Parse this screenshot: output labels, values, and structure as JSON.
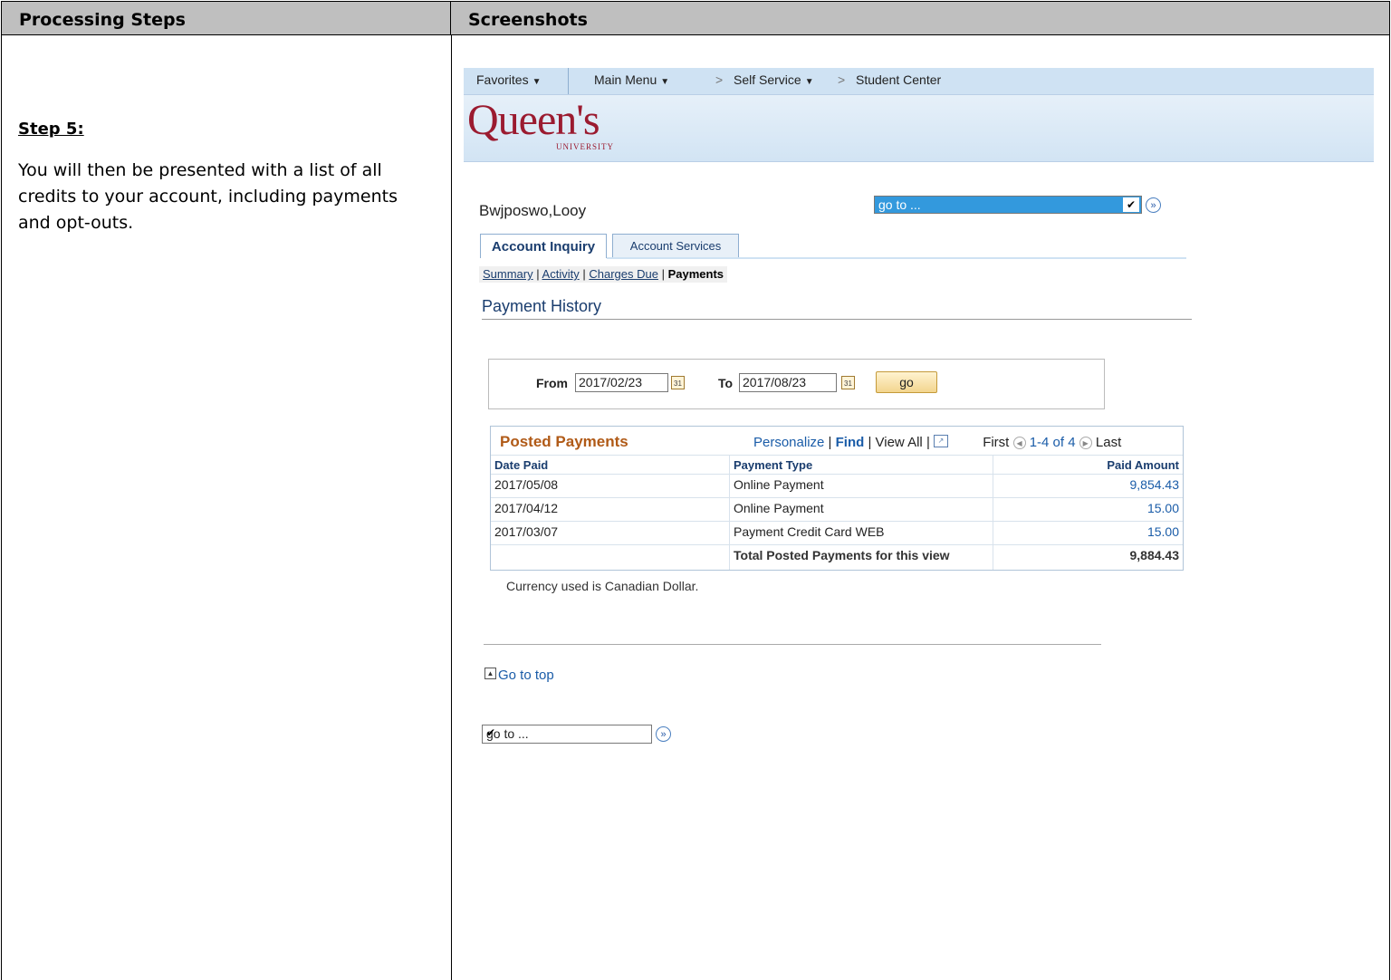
{
  "document": {
    "col_left_header": "Processing Steps",
    "col_right_header": "Screenshots",
    "step_title": "Step 5:",
    "step_text": "You will then be presented with a list of all credits to your account, including payments and opt-outs."
  },
  "app": {
    "topbar": {
      "favorites": "Favorites",
      "main_menu": "Main Menu",
      "self_service": "Self Service",
      "student_center": "Student Center",
      "crumb_sep": ">"
    },
    "logo": {
      "main": "Queen's",
      "sub": "UNIVERSITY"
    },
    "user_name": "Bwjposwo,Looy",
    "goto_top_value": "go to ...",
    "tabs": [
      {
        "label": "Account Inquiry"
      },
      {
        "label": "Account Services"
      }
    ],
    "subnav": {
      "summary": "Summary",
      "activity": "Activity",
      "charges_due": "Charges Due",
      "payments": "Payments",
      "sep": "|"
    },
    "page_title": "Payment History",
    "filter": {
      "from_label": "From",
      "from_value": "2017/02/23",
      "to_label": "To",
      "to_value": "2017/08/23",
      "go_label": "go"
    },
    "grid": {
      "title": "Posted Payments",
      "personalize": "Personalize",
      "find": "Find",
      "view_all": "View All",
      "first": "First",
      "range": "1-4 of 4",
      "last": "Last",
      "columns": [
        "Date Paid",
        "Payment Type",
        "Paid Amount"
      ],
      "rows": [
        {
          "date": "2017/05/08",
          "type": "Online Payment",
          "amount": "9,854.43"
        },
        {
          "date": "2017/04/12",
          "type": "Online Payment",
          "amount": "15.00"
        },
        {
          "date": "2017/03/07",
          "type": "Payment Credit Card WEB",
          "amount": "15.00"
        }
      ],
      "total_label": "Total Posted Payments for this view",
      "total_amount": "9,884.43"
    },
    "currency_note": "Currency used is Canadian Dollar.",
    "go_to_top": "Go to top",
    "goto_bottom_value": "go to ..."
  }
}
